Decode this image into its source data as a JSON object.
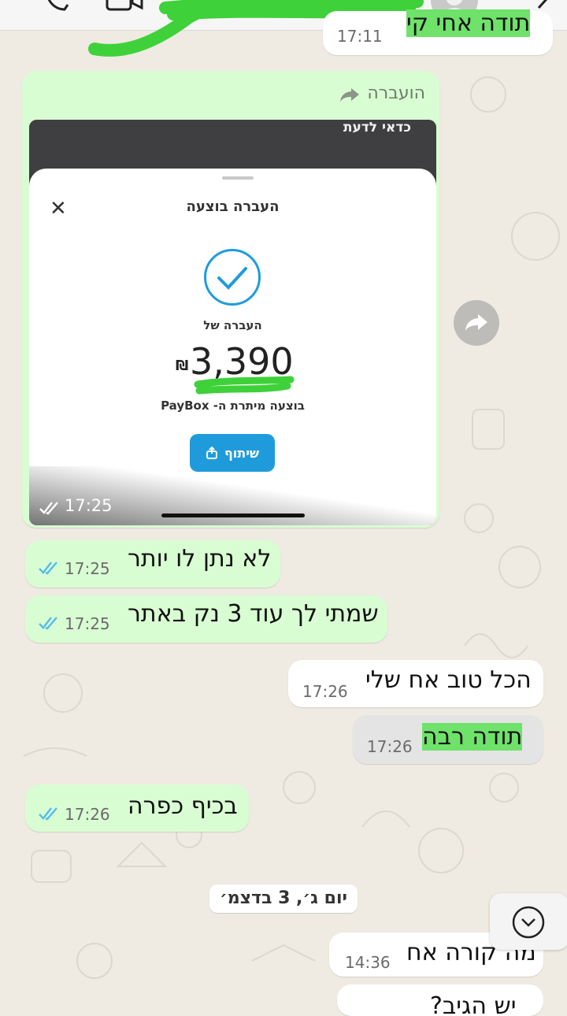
{
  "header": {
    "call_icon": "phone-icon",
    "video_icon": "video-icon",
    "avatar_icon": "avatar-icon",
    "menu_icon": "chevron-icon"
  },
  "messages": [
    {
      "id": "m0",
      "direction": "outgoing",
      "text": "תודה אחי קי",
      "time": "17:11"
    },
    {
      "id": "m2",
      "direction": "incoming",
      "text": "לא נתן לו יותר",
      "time": "17:25"
    },
    {
      "id": "m3",
      "direction": "incoming",
      "text": "שמתי לך עוד 3 נק באתר",
      "time": "17:25"
    },
    {
      "id": "m4",
      "direction": "outgoing",
      "text": "הכל טוב אח שלי",
      "time": "17:26"
    },
    {
      "id": "m5",
      "direction": "outgoing",
      "text": "תודה רבה",
      "time": "17:26"
    },
    {
      "id": "m6",
      "direction": "incoming",
      "text": "בכיף כפרה",
      "time": "17:26"
    },
    {
      "id": "m7",
      "direction": "outgoing",
      "text": "מה קורה אח",
      "time": "14:36"
    },
    {
      "id": "m8",
      "direction": "outgoing",
      "text": "יש הגיב?",
      "time": ""
    }
  ],
  "forwarded": {
    "label": "הועברה",
    "media_top_text": "כדאי לדעת",
    "time": "17:25",
    "sheet": {
      "title": "העברה בוצעה",
      "transfer_of": "העברה של",
      "amount": "3,390",
      "currency": "₪",
      "via": "בוצעה מיתרת ה- PayBox",
      "share_label": "שיתוף"
    }
  },
  "date_separator": "יום ג׳, 3 בדצמ׳",
  "colors": {
    "outgoing_bubble": "#d9fdd3",
    "incoming_bubble": "#ffffff",
    "tick_blue": "#53bdeb",
    "paybox_blue": "#1f9bdc",
    "highlight_green": "#6fe26a"
  }
}
